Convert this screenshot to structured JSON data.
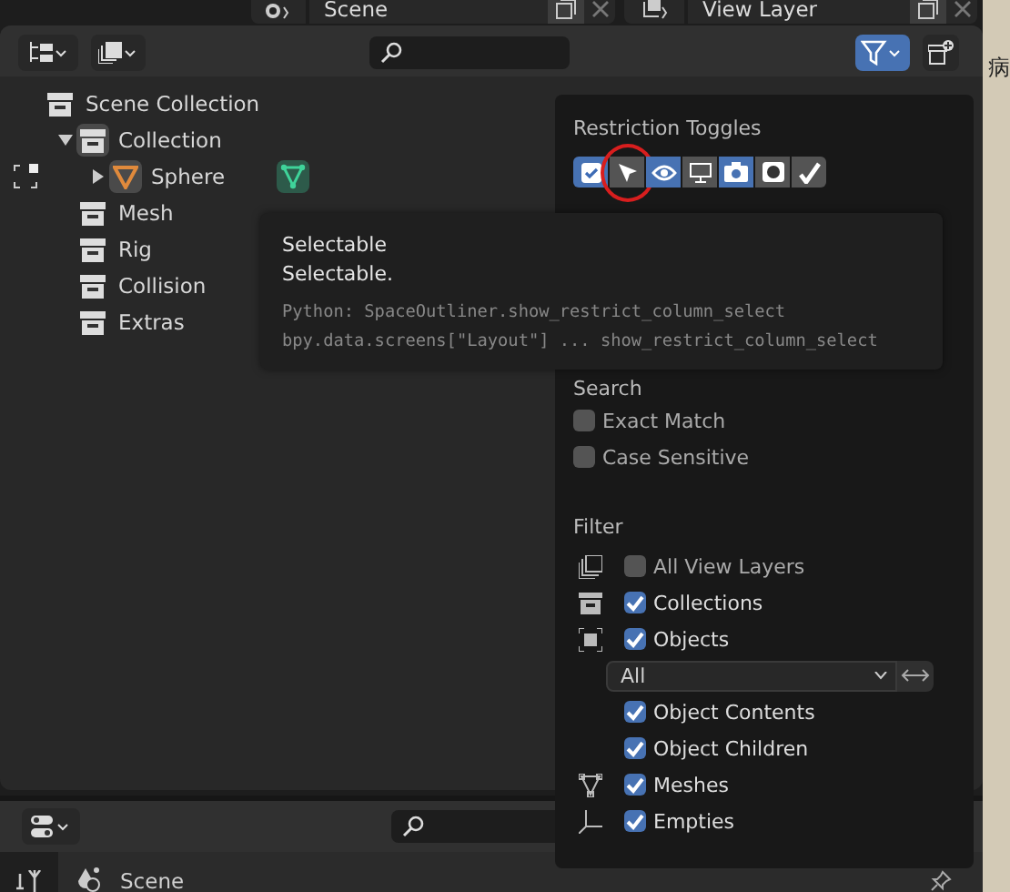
{
  "top_bar": {
    "scene": "Scene",
    "view_layer": "View Layer"
  },
  "outliner": {
    "filter_active": true,
    "tree": [
      {
        "label": "Scene Collection",
        "kind": "scene",
        "children": [
          {
            "label": "Collection",
            "kind": "collection",
            "expanded": true,
            "children": [
              {
                "label": "Sphere",
                "kind": "object",
                "expanded": false
              }
            ]
          },
          {
            "label": "Mesh",
            "kind": "collection"
          },
          {
            "label": "Rig",
            "kind": "collection"
          },
          {
            "label": "Collision",
            "kind": "collection"
          },
          {
            "label": "Extras",
            "kind": "collection"
          }
        ]
      }
    ]
  },
  "filter_popup": {
    "restriction_title": "Restriction Toggles",
    "toggles": [
      {
        "kind": "checkbox",
        "on": true,
        "highlighted": false
      },
      {
        "kind": "select",
        "on": false,
        "highlighted": true
      },
      {
        "kind": "eye",
        "on": true,
        "highlighted": false
      },
      {
        "kind": "monitor",
        "on": false,
        "highlighted": false
      },
      {
        "kind": "camera",
        "on": true,
        "highlighted": false
      },
      {
        "kind": "holdout",
        "on": false,
        "highlighted": false
      },
      {
        "kind": "indirect",
        "on": false,
        "highlighted": false
      }
    ],
    "search_title": "Search",
    "search_options": [
      {
        "label": "Exact Match",
        "checked": false
      },
      {
        "label": "Case Sensitive",
        "checked": false
      }
    ],
    "filter_title": "Filter",
    "filters": [
      {
        "kind": "checkbox",
        "label": "All View Layers",
        "checked": false
      },
      {
        "kind": "checkbox",
        "label": "Collections",
        "checked": true
      },
      {
        "kind": "checkbox",
        "label": "Objects",
        "checked": true
      },
      {
        "kind": "dropdown",
        "value": "All"
      },
      {
        "kind": "checkbox",
        "label": "Object Contents",
        "checked": true
      },
      {
        "kind": "checkbox",
        "label": "Object Children",
        "checked": true
      },
      {
        "kind": "checkbox",
        "label": "Meshes",
        "checked": true
      },
      {
        "kind": "checkbox",
        "label": "Empties",
        "checked": true
      }
    ]
  },
  "tooltip": {
    "title": "Selectable",
    "description": "Selectable.",
    "python": [
      "Python: SpaceOutliner.show_restrict_column_select",
      "bpy.data.screens[\"Layout\"] ... show_restrict_column_select"
    ]
  },
  "properties": {
    "context": "Scene"
  },
  "side_window": {
    "text": "病"
  }
}
